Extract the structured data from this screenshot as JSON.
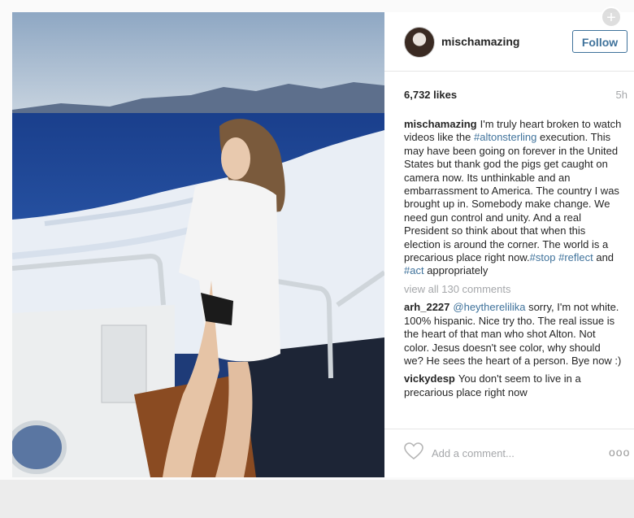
{
  "post": {
    "username": "mischamazing",
    "follow_label": "Follow",
    "likes": "6,732 likes",
    "time": "5h",
    "caption": {
      "user": "mischamazing",
      "part1": "I'm truly heart broken to watch videos like the ",
      "tag1": "#altonsterling",
      "part2": " execution. This may have been going on forever in the United States but thank god the pigs get caught on camera now. Its unthinkable and an embarrassment to America. The country I was brought up in. Somebody make change. We need gun control and unity. And a real President so think about that when this election is around the corner. The world is a precarious place right now.",
      "tag2": "#stop",
      "tag3": "#reflect",
      "part3": " and ",
      "tag4": "#act",
      "part4": " appropriately"
    },
    "view_all": "view all 130 comments",
    "comments": [
      {
        "user": "arh_2227",
        "mention": "@heytherelilika",
        "text": " sorry, I'm not white. 100% hispanic. Nice try tho. The real issue is the heart of that man who shot Alton. Not color. Jesus doesn't see color, why should we? He sees the heart of a person. Bye now :)"
      },
      {
        "user": "vickydesp",
        "text": "You don't seem to live in a precarious place right now"
      }
    ],
    "add_comment_placeholder": "Add a comment...",
    "more_label": "ooo"
  },
  "icons": {
    "heart": "heart-icon",
    "plus": "plus-icon",
    "more": "more-options-icon"
  },
  "colors": {
    "link": "#3f729b",
    "muted": "#a5a7aa"
  }
}
